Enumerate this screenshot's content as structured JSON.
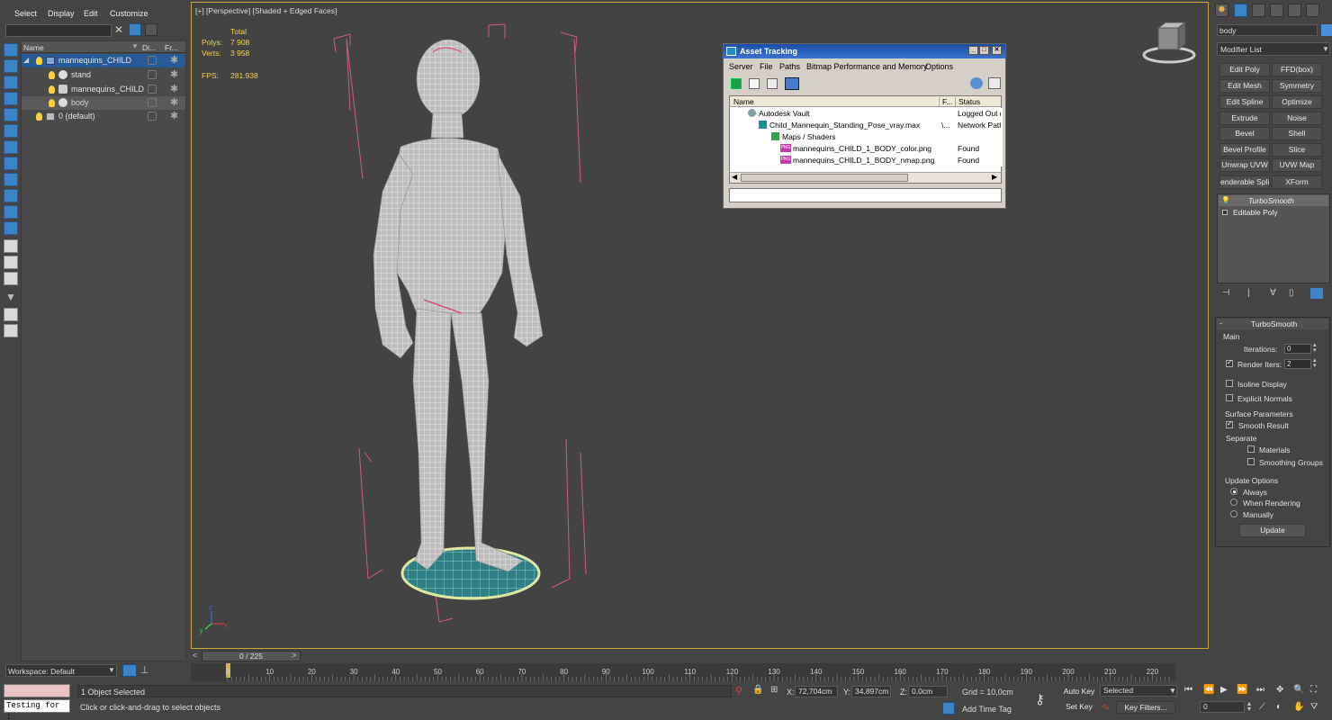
{
  "scene_explorer": {
    "menu": [
      "Select",
      "Display",
      "Edit",
      "Customize"
    ],
    "columns": {
      "name": "Name",
      "display": "Di...",
      "freeze": "Fr..."
    },
    "rows": [
      {
        "label": "mannequins_CHILD",
        "selected": true
      },
      {
        "label": "stand"
      },
      {
        "label": "mannequins_CHILD"
      },
      {
        "label": "body"
      },
      {
        "label": "0 (default)"
      }
    ],
    "workspace": "Workspace: Default"
  },
  "viewport": {
    "label": "[+] [Perspective] [Shaded + Edged Faces]",
    "stats": {
      "total": "Total",
      "polys_label": "Polys:",
      "polys": "7 908",
      "verts_label": "Verts:",
      "verts": "3 958",
      "fps_label": "FPS:",
      "fps": "281.938"
    },
    "axis": {
      "x": "x",
      "y": "y",
      "z": "z"
    }
  },
  "asset_tracking": {
    "title": "Asset Tracking",
    "menu": [
      "Server",
      "File",
      "Paths",
      "Bitmap Performance and Memory",
      "Options"
    ],
    "columns": [
      "Name",
      "F...",
      "Status"
    ],
    "rows": [
      {
        "name": "Autodesk Vault",
        "f": "",
        "status": "Logged Out ("
      },
      {
        "name": "Child_Mannequin_Standing_Pose_vray.max",
        "f": "\\...",
        "status": "Network Path"
      },
      {
        "name": "Maps / Shaders",
        "f": "",
        "status": ""
      },
      {
        "name": "mannequins_CHILD_1_BODY_color.png",
        "f": "",
        "status": "Found"
      },
      {
        "name": "mannequins_CHILD_1_BODY_nmap.png",
        "f": "",
        "status": "Found"
      }
    ],
    "png_badge": "PNG"
  },
  "command_panel": {
    "object_name": "body",
    "modifier_list": "Modifier List",
    "modifier_buttons": [
      [
        "Edit Poly",
        "FFD(box)"
      ],
      [
        "Edit Mesh",
        "Symmetry"
      ],
      [
        "Edit Spline",
        "Optimize"
      ],
      [
        "Extrude",
        "Noise"
      ],
      [
        "Bevel",
        "Shell"
      ],
      [
        "Bevel Profile",
        "Slice"
      ],
      [
        "Unwrap UVW",
        "UVW Map"
      ],
      [
        "enderable Splin",
        "XForm"
      ]
    ],
    "stack": [
      "TurboSmooth",
      "Editable Poly"
    ],
    "rollout": {
      "title": "TurboSmooth",
      "main": "Main",
      "iterations_label": "Iterations:",
      "iterations": "0",
      "render_iters_label": "Render Iters:",
      "render_iters": "2",
      "isoline": "Isoline Display",
      "explicit_normals": "Explicit Normals",
      "surface_params": "Surface Parameters",
      "smooth_result": "Smooth Result",
      "separate": "Separate",
      "materials": "Materials",
      "smoothing_groups": "Smoothing Groups",
      "update_options": "Update Options",
      "always": "Always",
      "when_rendering": "When Rendering",
      "manually": "Manually",
      "update": "Update"
    }
  },
  "timeline": {
    "frame": "0 / 225",
    "ticks": [
      "0",
      "10",
      "20",
      "30",
      "40",
      "50",
      "60",
      "70",
      "80",
      "90",
      "100",
      "110",
      "120",
      "130",
      "140",
      "150",
      "160",
      "170",
      "180",
      "190",
      "200",
      "210",
      "220"
    ]
  },
  "status_bar": {
    "maxscript": "Testing for :",
    "selection": "1 Object Selected",
    "prompt": "Click or click-and-drag to select objects",
    "x_label": "X:",
    "x": "72,704cm",
    "y_label": "Y:",
    "y": "34,897cm",
    "z_label": "Z:",
    "z": "0,0cm",
    "grid": "Grid = 10,0cm",
    "add_time_tag": "Add Time Tag",
    "auto_key": "Auto Key",
    "set_key": "Set Key",
    "selected": "Selected",
    "key_filters": "Key Filters...",
    "frame_field": "0"
  }
}
